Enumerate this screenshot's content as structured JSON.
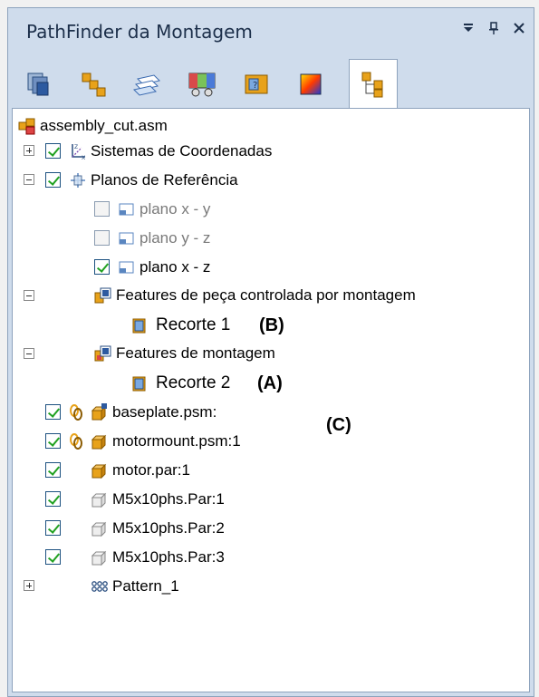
{
  "window": {
    "title": "PathFinder da Montagem"
  },
  "tabs": [
    {
      "name": "tab-assembly-pathfinder"
    },
    {
      "name": "tab-parts-library"
    },
    {
      "name": "tab-layers"
    },
    {
      "name": "tab-interference"
    },
    {
      "name": "tab-features"
    },
    {
      "name": "tab-color"
    },
    {
      "name": "tab-pathfinder-tree"
    }
  ],
  "tree": {
    "root": "assembly_cut.asm",
    "coord_systems": "Sistemas de Coordenadas",
    "ref_planes": "Planos de Referência",
    "plane_xy": "plano x - y",
    "plane_yz": "plano y - z",
    "plane_xz": "plano x - z",
    "part_features": "Features de peça controlada por montagem",
    "cut1": "Recorte 1",
    "asm_features": "Features de montagem",
    "cut2": "Recorte 2",
    "baseplate": "baseplate.psm:",
    "motormount": "motormount.psm:1",
    "motor": "motor.par:1",
    "m5_1": "M5x10phs.Par:1",
    "m5_2": "M5x10phs.Par:2",
    "m5_3": "M5x10phs.Par:3",
    "pattern": "Pattern_1"
  },
  "callouts": {
    "b": "(B)",
    "a": "(A)",
    "c": "(C)"
  },
  "colors": {
    "panel_bg": "#cfdcec",
    "check_green": "#21a121",
    "icon_orange": "#e8a21a"
  }
}
